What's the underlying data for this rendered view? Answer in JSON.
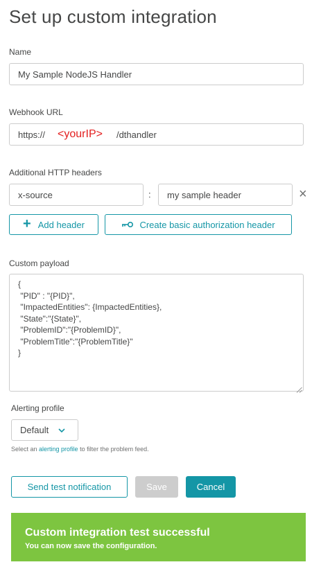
{
  "page": {
    "title": "Set up custom integration"
  },
  "name": {
    "label": "Name",
    "value": "My Sample NodeJS Handler"
  },
  "webhook": {
    "label": "Webhook URL",
    "prefix": "https://",
    "placeholder_marker": "<yourIP>",
    "suffix": "/dthandler"
  },
  "headers": {
    "label": "Additional HTTP headers",
    "key": "x-source",
    "separator": ":",
    "value": "my sample header",
    "remove_glyph": "×",
    "add_label": "Add header",
    "auth_label": "Create basic authorization header"
  },
  "payload": {
    "label": "Custom payload",
    "lines": [
      "{",
      " \"PID\" : \"{PID}\",",
      " \"ImpactedEntities\": {ImpactedEntities},",
      " \"State\":\"{State}\",",
      " \"ProblemID\":\"{ProblemID}\",",
      " \"ProblemTitle\":\"{ProblemTitle}\"",
      "}"
    ]
  },
  "alerting": {
    "label": "Alerting profile",
    "selected": "Default",
    "help_prefix": "Select an ",
    "help_link": "alerting profile",
    "help_suffix": " to filter the problem feed."
  },
  "actions": {
    "test_label": "Send test notification",
    "save_label": "Save",
    "cancel_label": "Cancel"
  },
  "notification": {
    "title": "Custom integration test successful",
    "subtitle": "You can now save the configuration."
  },
  "colors": {
    "accent": "#1496a6",
    "success": "#7dc540",
    "marker": "#e31e1e"
  }
}
